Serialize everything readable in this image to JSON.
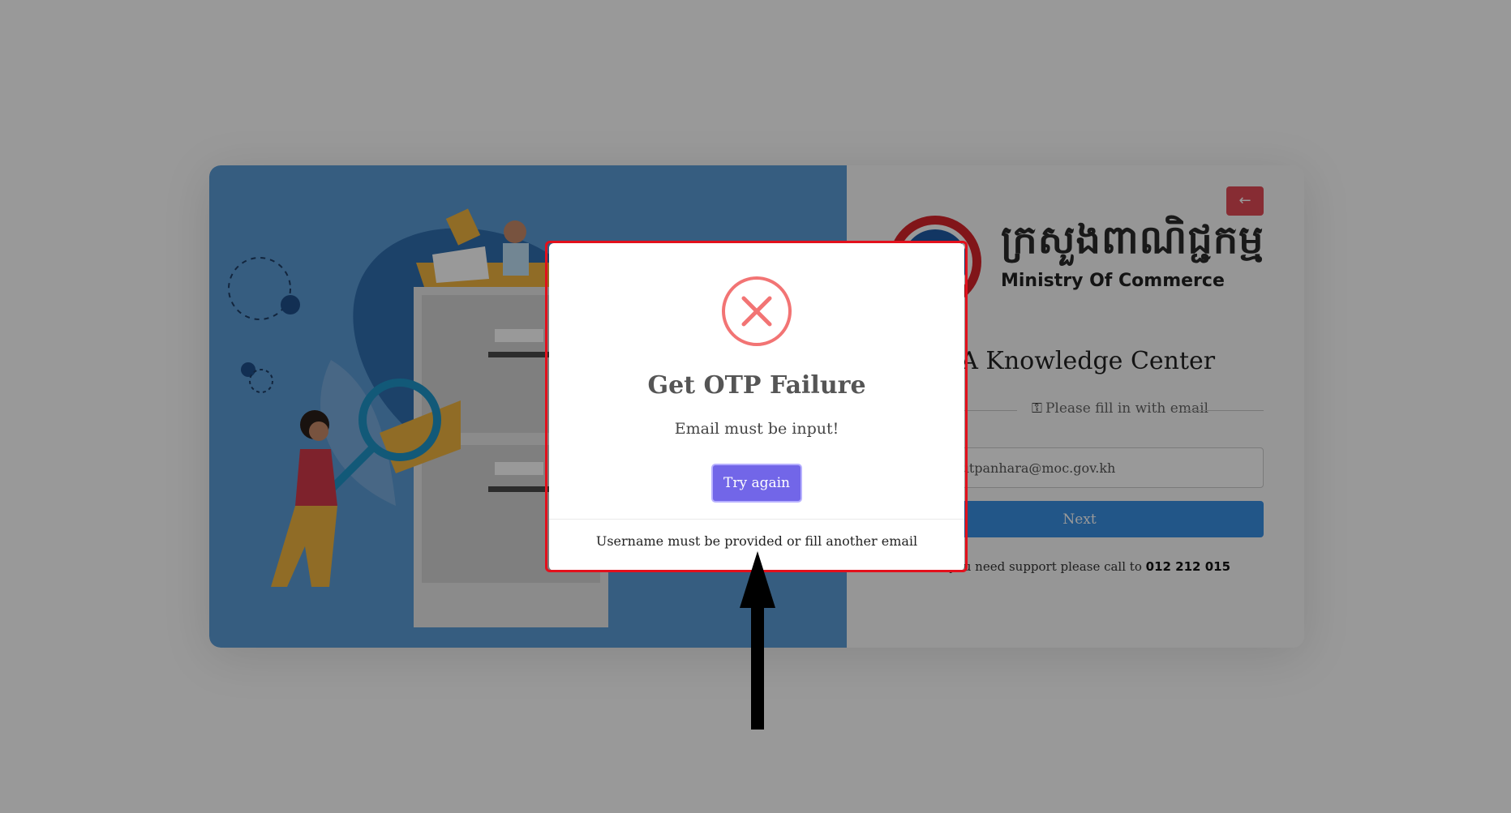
{
  "login": {
    "back_icon": "arrow-left-icon",
    "khmer_name": "ក្រសួងពាណិជ្ជកម្ម",
    "english_name": "Ministry Of Commerce",
    "title": "ITA Knowledge Center",
    "hint": "Please fill in with email",
    "hint_icon": "key-icon",
    "email_value": "chhouk.titpanhara@moc.gov.kh",
    "next_label": "Next",
    "support_text": "If you need support please call to",
    "support_phone": "012 212 015"
  },
  "modal": {
    "icon": "error-x-icon",
    "title": "Get OTP Failure",
    "message": "Email must be input!",
    "button_label": "Try again",
    "footer": "Username must be provided or fill another email"
  },
  "colors": {
    "overlay": "#000000",
    "error": "#f27474",
    "try_button": "#7266e8",
    "highlight": "#e3101c",
    "illustration_bg": "#5b9bd5",
    "next_button": "#3a8fe3"
  }
}
